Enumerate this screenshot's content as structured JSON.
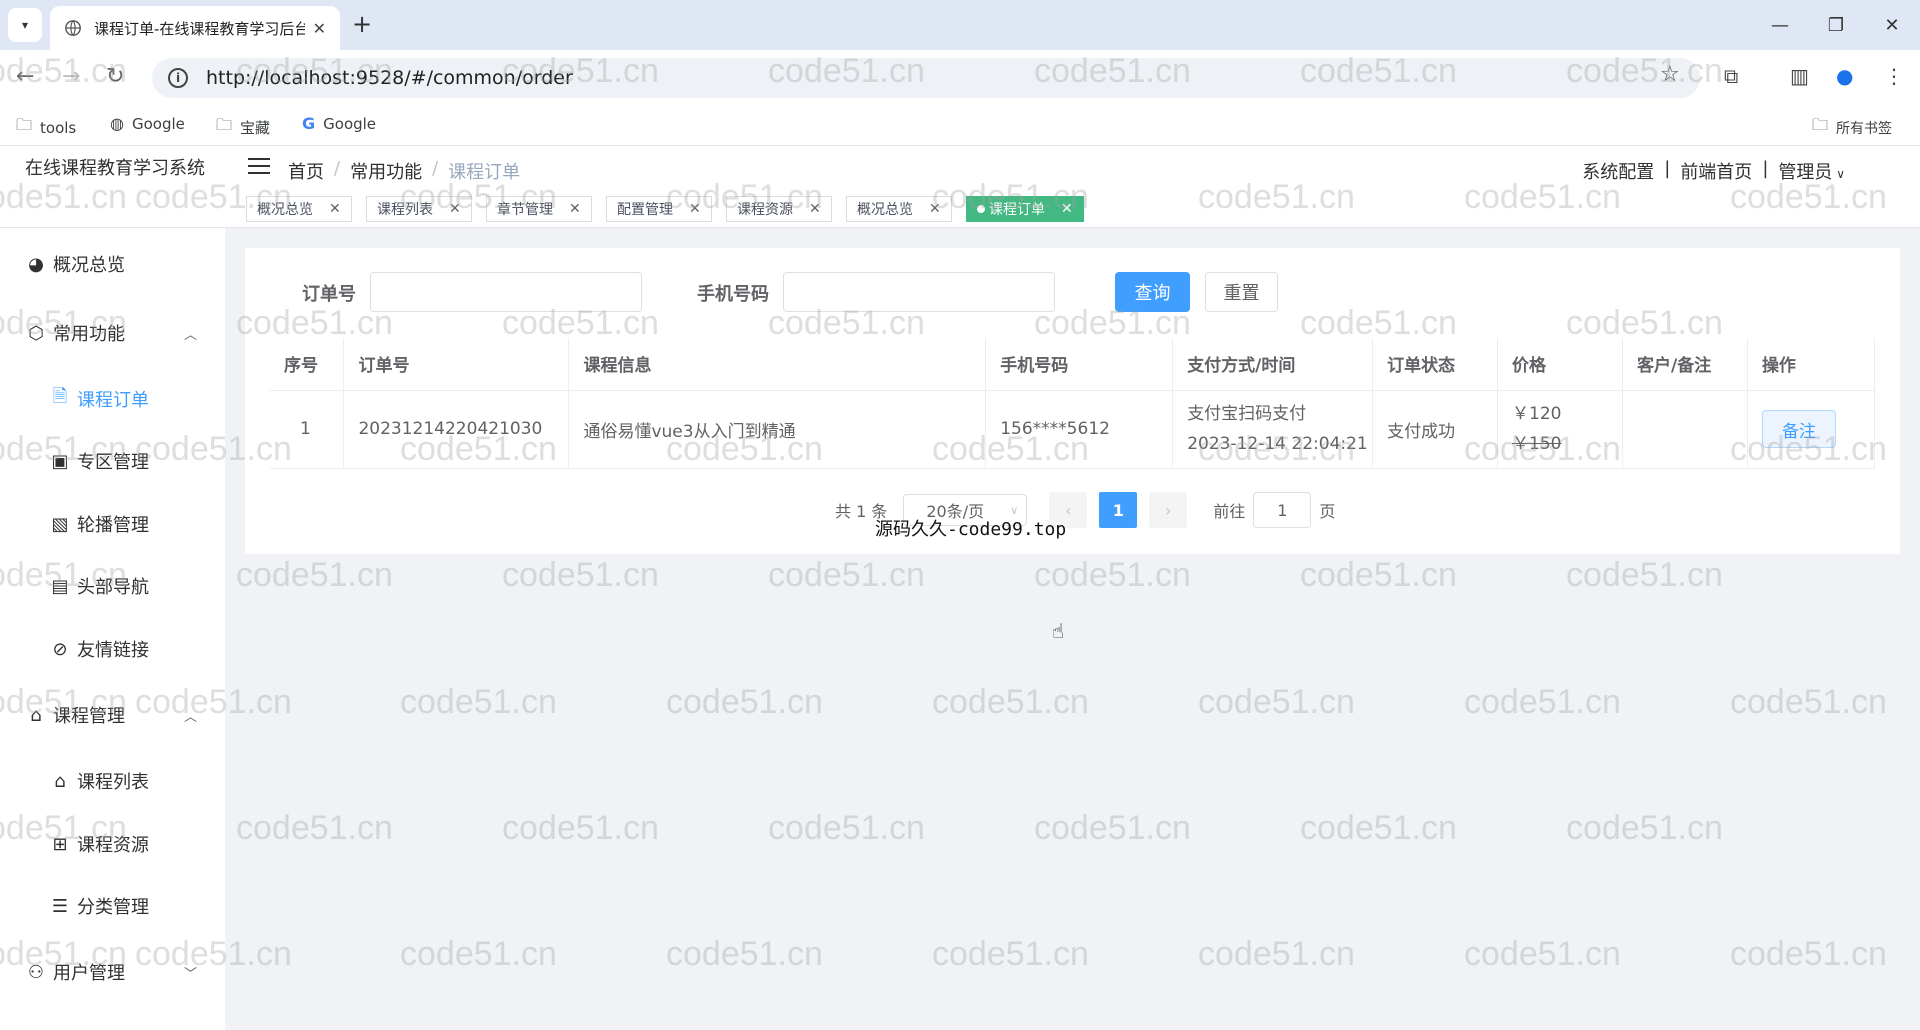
{
  "browser": {
    "tab_title": "课程订单-在线课程教育学习后台",
    "url": "http://localhost:9528/#/common/order",
    "bookmarks": [
      "tools",
      "Google",
      "宝藏",
      "Google"
    ],
    "all_bookmarks": "所有书签"
  },
  "header": {
    "app_title": "在线课程教育学习系统",
    "breadcrumb": [
      "首页",
      "常用功能",
      "课程订单"
    ],
    "right_links": [
      "系统配置",
      "前端首页",
      "管理员"
    ]
  },
  "tags": [
    {
      "label": "概况总览",
      "active": false
    },
    {
      "label": "课程列表",
      "active": false
    },
    {
      "label": "章节管理",
      "active": false
    },
    {
      "label": "配置管理",
      "active": false
    },
    {
      "label": "课程资源",
      "active": false
    },
    {
      "label": "概况总览",
      "active": false
    },
    {
      "label": "课程订单",
      "active": true
    }
  ],
  "sidebar": {
    "items": [
      {
        "label": "概况总览",
        "icon": "dashboard-icon"
      },
      {
        "label": "常用功能",
        "icon": "cube-icon"
      },
      {
        "label": "课程订单",
        "icon": "document-icon"
      },
      {
        "label": "专区管理",
        "icon": "play-box-icon"
      },
      {
        "label": "轮播管理",
        "icon": "image-icon"
      },
      {
        "label": "头部导航",
        "icon": "calendar-icon"
      },
      {
        "label": "友情链接",
        "icon": "link-icon"
      },
      {
        "label": "课程管理",
        "icon": "graduation-icon"
      },
      {
        "label": "课程列表",
        "icon": "graduation-icon"
      },
      {
        "label": "课程资源",
        "icon": "grid-icon"
      },
      {
        "label": "分类管理",
        "icon": "list-icon"
      },
      {
        "label": "用户管理",
        "icon": "users-icon"
      }
    ]
  },
  "filters": {
    "order_no_label": "订单号",
    "order_no_value": "",
    "phone_label": "手机号码",
    "phone_value": "",
    "search_button": "查询",
    "reset_button": "重置"
  },
  "table": {
    "columns": [
      "序号",
      "订单号",
      "课程信息",
      "手机号码",
      "支付方式/时间",
      "订单状态",
      "价格",
      "客户/备注",
      "操作"
    ],
    "rows": [
      {
        "index": "1",
        "order_no": "20231214220421030",
        "course": "通俗易懂vue3从入门到精通",
        "phone": "156****5612",
        "pay_method": "支付宝扫码支付",
        "pay_time": "2023-12-14 22:04:21",
        "status": "支付成功",
        "price": "￥120",
        "original_price": "￥150",
        "note": "",
        "action": "备注"
      }
    ]
  },
  "pagination": {
    "total_text": "共 1 条",
    "page_size": "20条/页",
    "current_page": "1",
    "goto_label": "前往",
    "goto_value": "1",
    "page_unit": "页"
  },
  "overlay_text": "源码久久-code99.top",
  "watermark_text": "code51.cn"
}
